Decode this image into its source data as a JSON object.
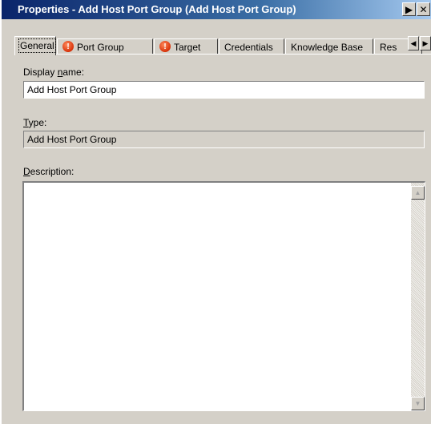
{
  "window": {
    "title": "Properties - Add Host Port Group (Add Host Port Group)"
  },
  "titlebar_buttons": {
    "arrow": "▶",
    "close": "✕"
  },
  "tabs": [
    {
      "label": "General",
      "active": true,
      "warning": false
    },
    {
      "label": "Port Group",
      "active": false,
      "warning": true
    },
    {
      "label": "Target",
      "active": false,
      "warning": true
    },
    {
      "label": "Credentials",
      "active": false,
      "warning": false
    },
    {
      "label": "Knowledge Base",
      "active": false,
      "warning": false
    },
    {
      "label": "Res",
      "active": false,
      "warning": false
    }
  ],
  "tab_scroll": {
    "left": "◀",
    "right": "▶"
  },
  "fields": {
    "display_name": {
      "label_pre": "Display ",
      "label_u": "n",
      "label_post": "ame:",
      "value": "Add Host Port Group"
    },
    "type": {
      "label_u": "T",
      "label_post": "ype:",
      "value": "Add Host Port Group"
    },
    "description": {
      "label_u": "D",
      "label_post": "escription:",
      "value": ""
    }
  },
  "scrollbar": {
    "up": "▲",
    "down": "▼"
  },
  "warning_glyph": "!"
}
